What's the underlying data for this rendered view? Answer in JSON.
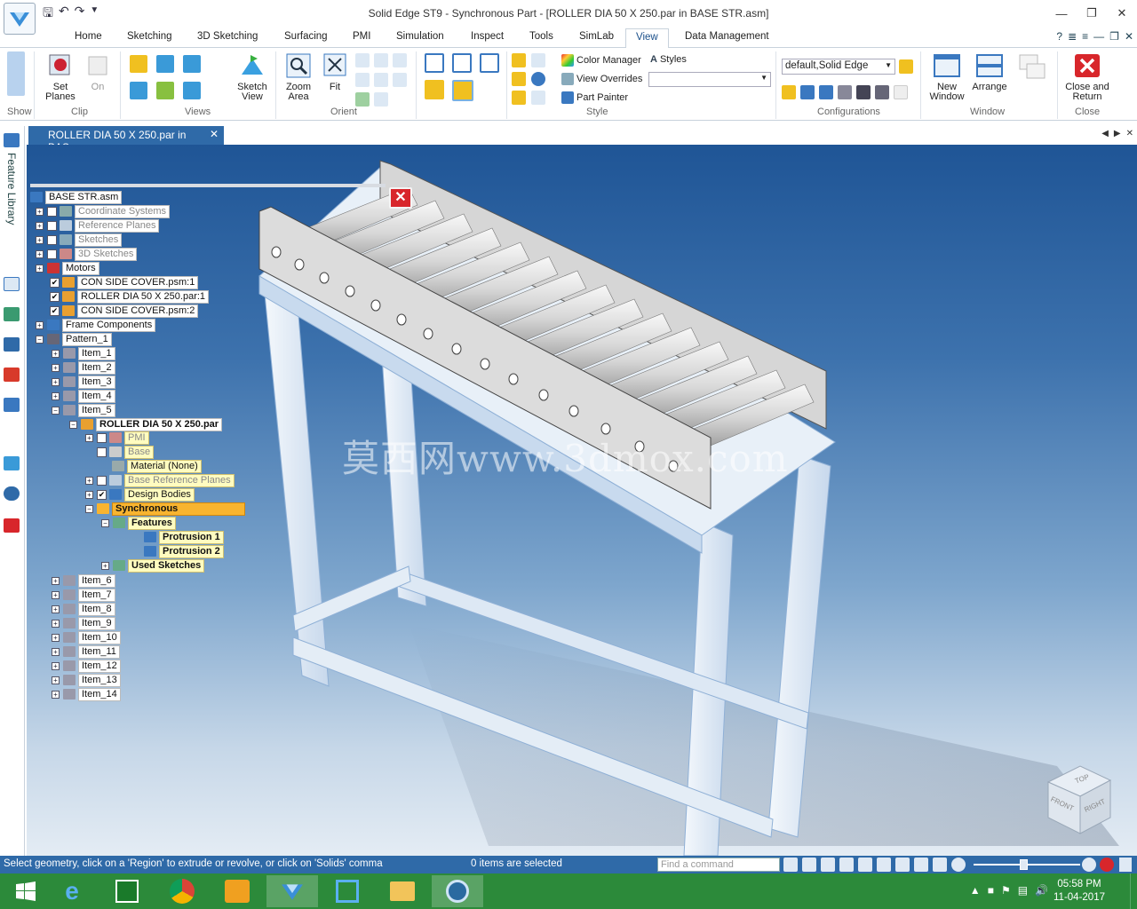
{
  "window": {
    "title": "Solid Edge ST9 - Synchronous Part - [ROLLER DIA 50 X 250.par in BASE STR.asm]",
    "controls": [
      "—",
      "❐",
      "✕"
    ]
  },
  "tabs": [
    "Home",
    "Sketching",
    "3D Sketching",
    "Surfacing",
    "PMI",
    "Simulation",
    "Inspect",
    "Tools",
    "SimLab",
    "View",
    "Data Management"
  ],
  "active_tab": "View",
  "ribbon": {
    "show_label": "Show",
    "clip": {
      "set_planes": "Set Planes",
      "on": "On",
      "label": "Clip"
    },
    "views": {
      "sketch_view": "Sketch View",
      "label": "Views"
    },
    "orient": {
      "zoom_area": "Zoom Area",
      "fit": "Fit",
      "label": "Orient"
    },
    "style": {
      "color_manager": "Color Manager",
      "styles": "Styles",
      "view_overrides": "View Overrides",
      "part_painter": "Part Painter",
      "label": "Style"
    },
    "configurations": {
      "selected": "default,Solid Edge",
      "label": "Configurations"
    },
    "window": {
      "new_window": "New Window",
      "arrange": "Arrange",
      "label": "Window"
    },
    "close": {
      "close_and_return": "Close and Return",
      "label": "Close"
    }
  },
  "document_tab": "ROLLER DIA 50 X 250.par in BAS...",
  "left_panel_label": "Feature Library",
  "tree": {
    "root": "BASE STR.asm",
    "items": [
      "Coordinate Systems",
      "Reference Planes",
      "Sketches",
      "3D Sketches",
      "Motors",
      "CON SIDE COVER.psm:1",
      "ROLLER DIA 50 X 250.par:1",
      "CON SIDE COVER.psm:2",
      "Frame Components",
      "Pattern_1",
      "Item_1",
      "Item_2",
      "Item_3",
      "Item_4",
      "Item_5",
      "ROLLER DIA 50 X 250.par",
      "PMI",
      "Base",
      "Material (None)",
      "Base Reference Planes",
      "Design Bodies",
      "Synchronous",
      "Features",
      "Protrusion 1",
      "Protrusion 2",
      "Used Sketches",
      "Item_6",
      "Item_7",
      "Item_8",
      "Item_9",
      "Item_10",
      "Item_11",
      "Item_12",
      "Item_13",
      "Item_14"
    ]
  },
  "watermark": "莫西网www.3dmox.com",
  "view_cube": {
    "top": "TOP",
    "front": "FRONT",
    "right": "RIGHT"
  },
  "status": {
    "message": "Select geometry, click on a 'Region' to extrude or revolve, or click on 'Solids' comma",
    "selection": "0 items are selected",
    "find_placeholder": "Find a command"
  },
  "taskbar": {
    "time": "05:58 PM",
    "date": "11-04-2017"
  },
  "colors": {
    "accent": "#2f6aa8",
    "taskbar": "#2c8a3a",
    "tree_highlight": "#f8b430",
    "tree_yellow": "#fffcc0"
  }
}
